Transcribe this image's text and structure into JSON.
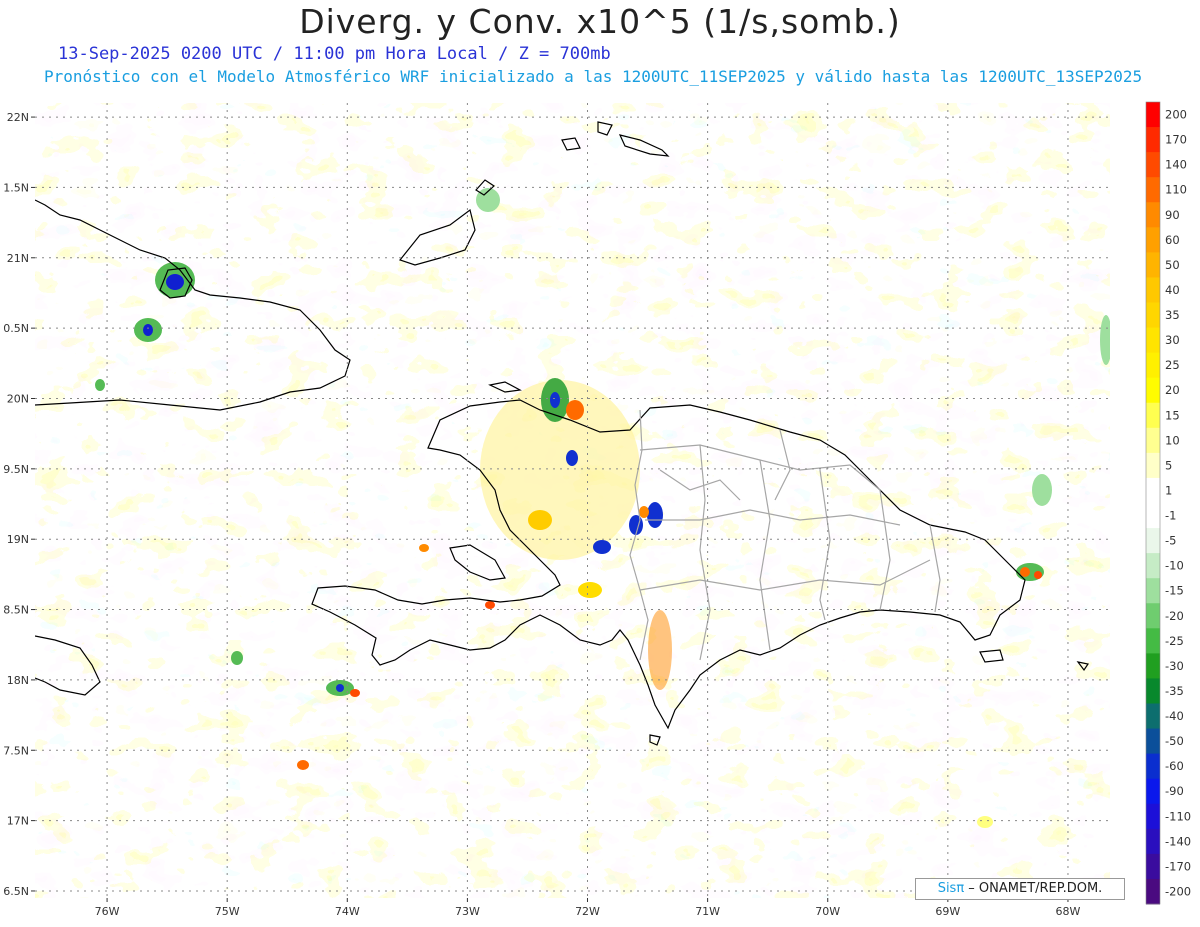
{
  "title": "Diverg. y Conv. x10^5 (1/s,somb.)",
  "subtitle_1": "13-Sep-2025  0200 UTC / 11:00 pm Hora Local / Z = 700mb",
  "subtitle_2": "Pronóstico con el Modelo Atmosférico WRF inicializado a las 1200UTC_11SEP2025 y válido hasta las  1200UTC_13SEP2025",
  "credit": {
    "brand": "Sisπ",
    "text": " – ONAMET/REP.DOM."
  },
  "axes": {
    "lat_labels": [
      "22N",
      "1.5N",
      "21N",
      "0.5N",
      "20N",
      "9.5N",
      "19N",
      "8.5N",
      "18N",
      "7.5N",
      "17N",
      "6.5N"
    ],
    "lat_values": [
      22.0,
      21.5,
      21.0,
      20.5,
      20.0,
      19.5,
      19.0,
      18.5,
      18.0,
      17.5,
      17.0,
      16.5
    ],
    "lon_labels": [
      "76W",
      "75W",
      "74W",
      "73W",
      "72W",
      "71W",
      "70W",
      "69W",
      "68W"
    ],
    "lon_values": [
      -76,
      -75,
      -74,
      -73,
      -72,
      -71,
      -70,
      -69,
      -68
    ],
    "lat_range": [
      16.45,
      22.1
    ],
    "lon_range": [
      -76.6,
      -67.65
    ]
  },
  "colorbar": {
    "labels": [
      "200",
      "170",
      "140",
      "110",
      "90",
      "60",
      "50",
      "40",
      "35",
      "30",
      "25",
      "20",
      "15",
      "10",
      "5",
      "1",
      "-1",
      "-5",
      "-10",
      "-15",
      "-20",
      "-25",
      "-30",
      "-35",
      "-40",
      "-50",
      "-60",
      "-90",
      "-110",
      "-140",
      "-170",
      "-200"
    ],
    "colors": [
      "#ff0000",
      "#ff2a00",
      "#ff4a00",
      "#ff6a00",
      "#ff8a00",
      "#ffa000",
      "#ffb400",
      "#ffc800",
      "#ffd600",
      "#ffe400",
      "#fff000",
      "#fffc00",
      "#ffff50",
      "#ffff90",
      "#ffffc8",
      "#ffffff",
      "#ffffff",
      "#eaf7ea",
      "#c6ecc6",
      "#9edf9e",
      "#6fcd6f",
      "#44bb44",
      "#209f20",
      "#08882c",
      "#0d6e6e",
      "#0b4f9a",
      "#0a2ecf",
      "#0a18ec",
      "#1c10d8",
      "#2a0fbe",
      "#3a0c9e",
      "#4a0a80"
    ]
  },
  "colors": {
    "coast": "#000000",
    "province_lines": "#a6a6a6",
    "grid": "#888888"
  }
}
